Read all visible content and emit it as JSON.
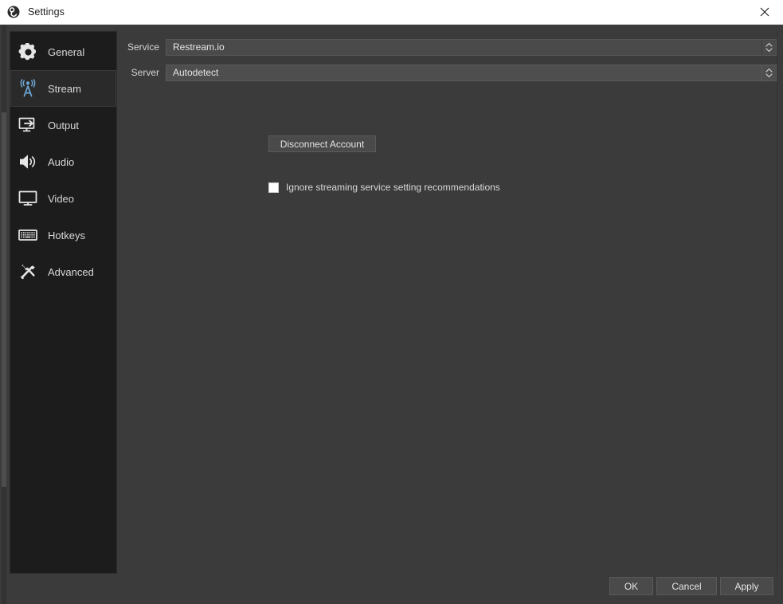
{
  "window": {
    "title": "Settings",
    "logo_icon": "obs-logo-icon",
    "close_icon": "close-icon",
    "titlebar_bg": "#ffffff",
    "titlebar_fg": "#1d1d1d"
  },
  "theme": {
    "pane_bg": "#3b3b3b",
    "sidebar_bg": "#1c1c1c",
    "selected_bg": "#2a2a2a",
    "field_bg": "#4a4a4a",
    "text": "#d8d8d8",
    "accent": "#5da0d8"
  },
  "sidebar": {
    "items": [
      {
        "label": "General",
        "icon": "gear-icon",
        "selected": false
      },
      {
        "label": "Stream",
        "icon": "broadcast-icon",
        "selected": true
      },
      {
        "label": "Output",
        "icon": "output-icon",
        "selected": false
      },
      {
        "label": "Audio",
        "icon": "speaker-icon",
        "selected": false
      },
      {
        "label": "Video",
        "icon": "monitor-icon",
        "selected": false
      },
      {
        "label": "Hotkeys",
        "icon": "keyboard-icon",
        "selected": false
      },
      {
        "label": "Advanced",
        "icon": "tools-icon",
        "selected": false
      }
    ]
  },
  "stream_page": {
    "service": {
      "label": "Service",
      "value": "Restream.io",
      "dropdown_icon": "spinner-updown-icon"
    },
    "server": {
      "label": "Server",
      "value": "Autodetect",
      "dropdown_icon": "spinner-updown-icon"
    },
    "disconnect_button": "Disconnect Account",
    "ignore_recommendations": {
      "label": "Ignore streaming service setting recommendations",
      "checked": false
    }
  },
  "footer": {
    "ok": "OK",
    "cancel": "Cancel",
    "apply": "Apply"
  }
}
